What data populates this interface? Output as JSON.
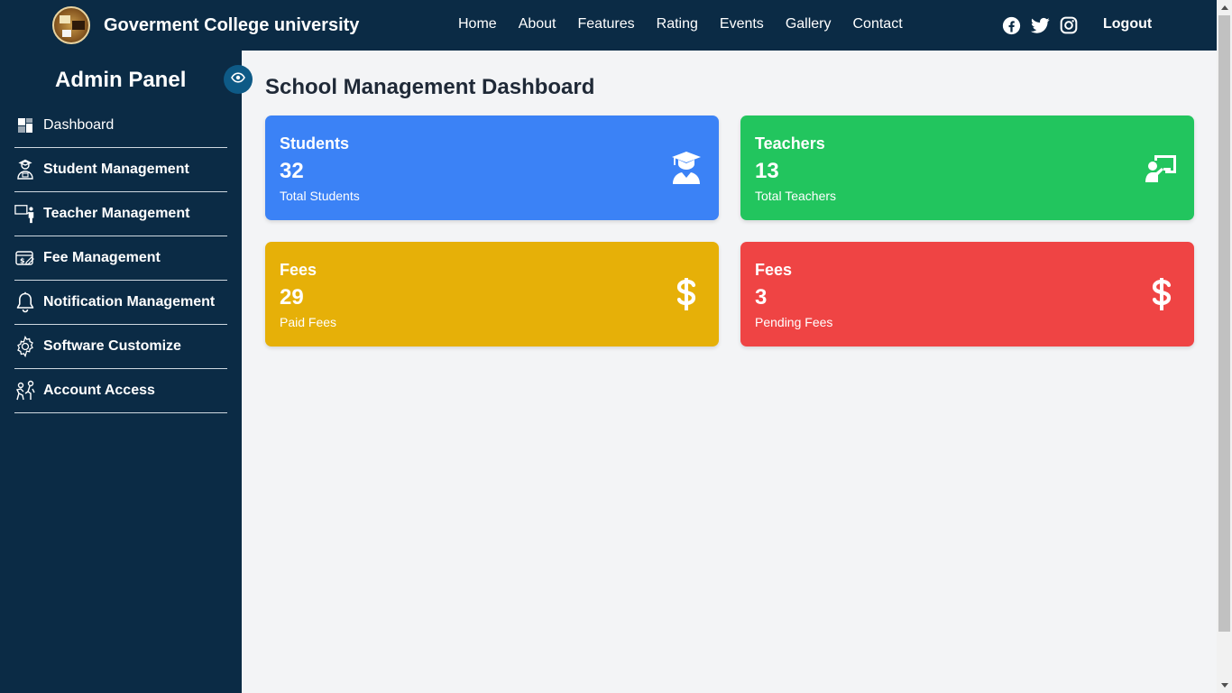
{
  "header": {
    "brand": "Goverment College university",
    "nav": [
      "Home",
      "About",
      "Features",
      "Rating",
      "Events",
      "Gallery",
      "Contact"
    ],
    "social_icons": [
      "facebook-icon",
      "twitter-icon",
      "instagram-icon"
    ],
    "logout_label": "Logout"
  },
  "sidebar": {
    "title": "Admin Panel",
    "items": [
      {
        "label": "Dashboard",
        "icon": "dashboard-icon"
      },
      {
        "label": "Student Management",
        "icon": "student-icon"
      },
      {
        "label": "Teacher Management",
        "icon": "teacher-icon"
      },
      {
        "label": "Fee Management",
        "icon": "fee-icon"
      },
      {
        "label": "Notification Management",
        "icon": "bell-icon"
      },
      {
        "label": "Software Customize",
        "icon": "gear-icon"
      },
      {
        "label": "Account Access",
        "icon": "account-access-icon"
      }
    ]
  },
  "main": {
    "title": "School Management Dashboard",
    "cards": [
      {
        "title": "Students",
        "value": "32",
        "subtitle": "Total Students",
        "color": "#3b82f6",
        "icon": "graduate-icon"
      },
      {
        "title": "Teachers",
        "value": "13",
        "subtitle": "Total Teachers",
        "color": "#22c55e",
        "icon": "teacher-board-icon"
      },
      {
        "title": "Fees",
        "value": "29",
        "subtitle": "Paid Fees",
        "color": "#e6b008",
        "icon": "dollar-icon"
      },
      {
        "title": "Fees",
        "value": "3",
        "subtitle": "Pending Fees",
        "color": "#ef4444",
        "icon": "dollar-icon"
      }
    ]
  },
  "colors": {
    "navbar": "#0b2b45",
    "sidebar": "#0b2b45",
    "eye_button": "#0e5a86",
    "background": "#f3f4f6"
  }
}
